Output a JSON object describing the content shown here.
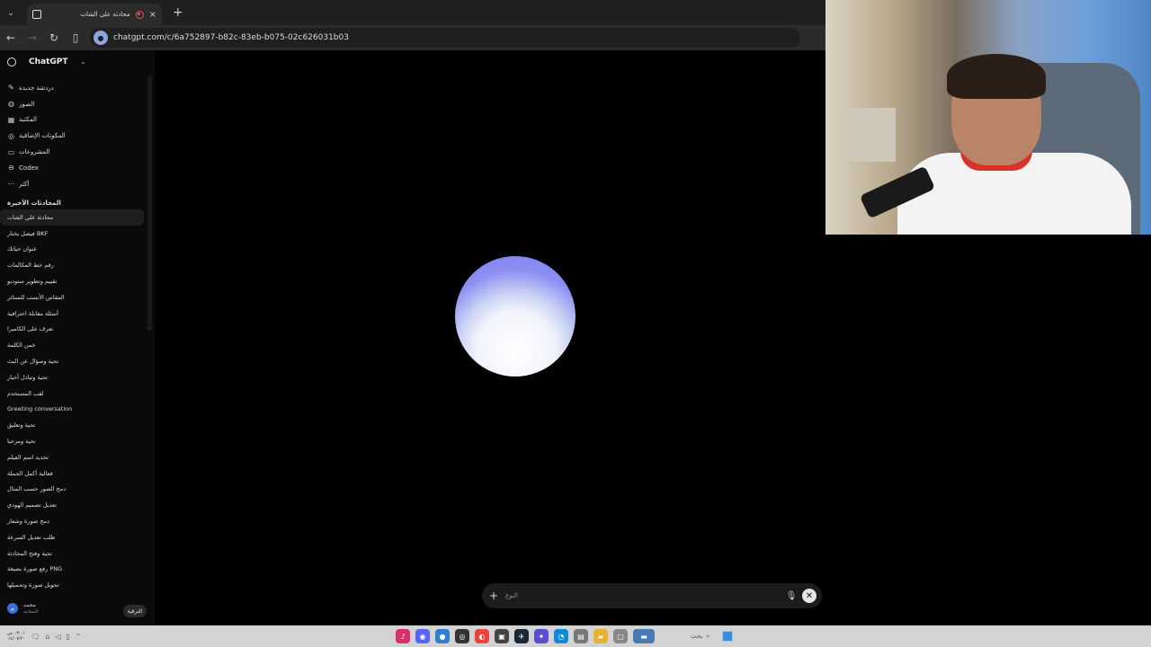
{
  "browser": {
    "tab_title": "محادثة على الشات",
    "new_tab": "+",
    "close_tab": "×",
    "url": "chatgpt.com/c/6a752897-b82c-83eb-b075-02c626031b03"
  },
  "sidebar": {
    "brand": "ChatGPT",
    "nav": [
      {
        "label": "دردشة جديدة",
        "icon": "edit-icon"
      },
      {
        "label": "الصور",
        "icon": "images-icon"
      },
      {
        "label": "المكتبة",
        "icon": "library-icon"
      },
      {
        "label": "المكونات الإضافية",
        "icon": "plugins-icon"
      },
      {
        "label": "المشروعات",
        "icon": "projects-icon"
      },
      {
        "label": "Codex",
        "icon": "codex-icon"
      },
      {
        "label": "أكثر",
        "icon": "more-icon"
      }
    ],
    "recent_title": "المحادثات الأخيرة",
    "conversations": [
      "محادثة على الشات",
      "فيصل يختار BKF",
      "عنوان حياتك",
      "رقم خط المكالمات",
      "تقييم وتطوير ستوديو",
      "المقاس الأنسب للستائر",
      "أسئلة مقابلة احترافية",
      "تعرف على الكاميرا",
      "خمن الكلمة",
      "تحية وسؤال عن البث",
      "تحية وتبادل أخبار",
      "لقب المستخدم",
      "Greeting conversation",
      "تحية وتعليق",
      "تحية ومرحبا",
      "تحديد اسم الفيلم",
      "فعالية أكمل الجملة",
      "دمج الصور حسب المثال",
      "تعديل تصميم الهودي",
      "دمج صورة وشعار",
      "طلب تعديل السرعة",
      "تحية وفتح المحادثة",
      "رفع صورة بصيغة PNG",
      "تحويل صورة وتحميلها"
    ],
    "user_name": "محمد",
    "user_plan": "المجانية",
    "upgrade_label": "الترقية"
  },
  "composer": {
    "placeholder": "النوع"
  },
  "taskbar": {
    "time": "٠٣:٠١ ص",
    "date": "١٤/٠٧/٢٠",
    "search_label": "بحث"
  },
  "colors": {
    "orb_top": "#7d80f2",
    "orb_bottom": "#ffffff",
    "taskbar": "#d3d3d3"
  }
}
